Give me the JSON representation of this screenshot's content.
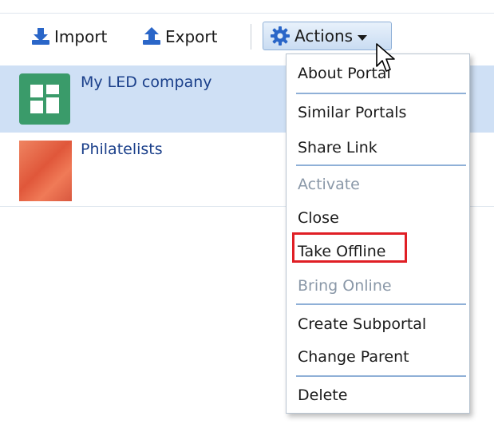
{
  "toolbar": {
    "import_label": "Import",
    "export_label": "Export",
    "actions_label": "Actions"
  },
  "rows": [
    {
      "name": "My LED company"
    },
    {
      "name": "Philatelists"
    }
  ],
  "menu": {
    "items": [
      {
        "label": "About Portal",
        "enabled": true
      },
      {
        "label": "Similar Portals",
        "enabled": true
      },
      {
        "label": "Share Link",
        "enabled": true
      },
      {
        "label": "Activate",
        "enabled": false
      },
      {
        "label": "Close",
        "enabled": true
      },
      {
        "label": "Take Offline",
        "enabled": true,
        "highlighted": true
      },
      {
        "label": "Bring Online",
        "enabled": false
      },
      {
        "label": "Create Subportal",
        "enabled": true
      },
      {
        "label": "Change Parent",
        "enabled": true
      },
      {
        "label": "Delete",
        "enabled": true
      }
    ]
  },
  "icons": {
    "import": "download-arrow-icon",
    "export": "upload-arrow-icon",
    "actions": "gear-icon",
    "dropdown": "chevron-down-icon",
    "cursor": "mouse-pointer-icon",
    "portal_logo": "portal-grid-icon"
  },
  "colors": {
    "accent_blue": "#2a66c8",
    "selected_row": "#cfe0f5",
    "link": "#1a3f8a",
    "disabled": "#8a98a8",
    "highlight_box": "#e01f25",
    "portal_green": "#3a9b6a",
    "portal_orange": "#e0573a"
  }
}
